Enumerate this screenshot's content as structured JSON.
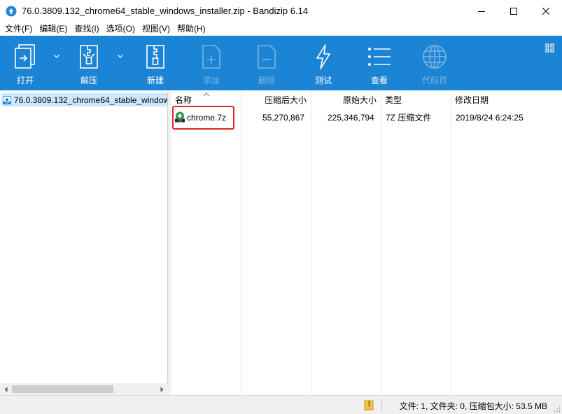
{
  "window": {
    "title": "76.0.3809.132_chrome64_stable_windows_installer.zip - Bandizip 6.14"
  },
  "menu": [
    "文件(F)",
    "编辑(E)",
    "查找(I)",
    "选项(O)",
    "视图(V)",
    "帮助(H)"
  ],
  "toolbar": {
    "open": "打开",
    "extract": "解压",
    "new": "新建",
    "add": "添加",
    "delete": "删除",
    "test": "测试",
    "view": "查看",
    "codepage": "代码页"
  },
  "tree": {
    "root": "76.0.3809.132_chrome64_stable_windows_installer.zip"
  },
  "columns": {
    "name": "名称",
    "packed": "压缩后大小",
    "original": "原始大小",
    "type": "类型",
    "modified": "修改日期"
  },
  "files": [
    {
      "name": "chrome.7z",
      "packed": "55,270,867",
      "original": "225,346,794",
      "type": "7Z 压缩文件",
      "modified": "2019/8/24 6:24:25"
    }
  ],
  "status": {
    "summary": "文件: 1, 文件夹: 0, 压缩包大小: 53.5 MB"
  },
  "colors": {
    "toolbar": "#1c84d4",
    "selection": "#cce8ff",
    "highlight": "#e0262a"
  }
}
